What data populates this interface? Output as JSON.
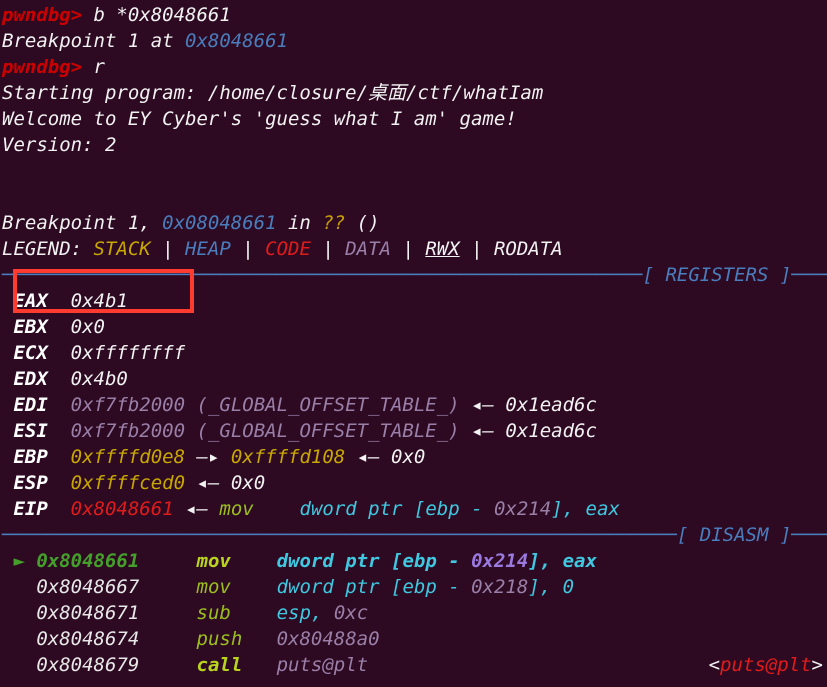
{
  "terminal": {
    "background_color": "#2d0a22",
    "foreground_color": "#f2f2f2",
    "prompt_color": "#cc0000",
    "annotation_box_color": "#ff3b30"
  },
  "session": {
    "prompt1": "pwndbg>",
    "command1": " b *0x8048661",
    "breakpoint_set_prefix": "Breakpoint 1 at ",
    "breakpoint_set_addr": "0x8048661",
    "prompt2": "pwndbg>",
    "command2": " r",
    "starting_program": "Starting program: /home/closure/桌面/ctf/whatIam",
    "welcome": "Welcome to EY Cyber's 'guess what I am' game!",
    "version": "Version: 2",
    "hit_prefix": "Breakpoint 1, ",
    "hit_addr": "0x08048661",
    "hit_in": " in ",
    "hit_fn": "??",
    "hit_paren": " ()"
  },
  "legend": {
    "label": "LEGEND: ",
    "items": [
      {
        "text": "STACK",
        "color": "#c8a800"
      },
      {
        "text": "HEAP",
        "color": "#4a7dbd"
      },
      {
        "text": "CODE",
        "color": "#e01b1b"
      },
      {
        "text": "DATA",
        "color": "#9a7fa8"
      },
      {
        "text": "RWX",
        "color": "#f2f2f2"
      },
      {
        "text": "RODATA",
        "color": "#f2f2f2"
      }
    ],
    "separator": " | "
  },
  "sections": {
    "registers_title": "[ REGISTERS ]",
    "registers_dashes_left": "────────────────────────────────────────────────────────",
    "registers_dashes_right": "────────────────",
    "disasm_title": "[ DISASM ]",
    "disasm_dashes_left": "───────────────────────────────────────────────────────────",
    "disasm_dashes_right": "───────────────"
  },
  "registers": [
    {
      "name": "EAX",
      "value": "0x4b1",
      "value_class": "white",
      "rest": "",
      "highlighted": true
    },
    {
      "name": "EBX",
      "value": "0x0",
      "value_class": "white",
      "rest": ""
    },
    {
      "name": "ECX",
      "value": "0xffffffff",
      "value_class": "white",
      "rest": ""
    },
    {
      "name": "EDX",
      "value": "0x4b0",
      "value_class": "white",
      "rest": ""
    },
    {
      "name": "EDI",
      "value": "0xf7fb2000 (_GLOBAL_OFFSET_TABLE_)",
      "value_class": "data",
      "arrow": "◂—",
      "rest": "0x1ead6c"
    },
    {
      "name": "ESI",
      "value": "0xf7fb2000 (_GLOBAL_OFFSET_TABLE_)",
      "value_class": "data",
      "arrow": "◂—",
      "rest": "0x1ead6c"
    },
    {
      "name": "EBP",
      "value": "0xffffd0e8",
      "value_class": "stack",
      "arrow": "—▸",
      "rest": "0xffffd108",
      "arrow2": "◂—",
      "rest2": "0x0"
    },
    {
      "name": "ESP",
      "value": "0xffffced0",
      "value_class": "stack",
      "arrow": "◂—",
      "rest": "0x0"
    },
    {
      "name": "EIP",
      "value": "0x8048661",
      "value_class": "code",
      "arrow": "◂—",
      "rest": "mov    dword ptr [ebp - 0x214], eax"
    }
  ],
  "eip_disasm": {
    "mnemonic": "mov",
    "operand_pre": "dword ptr [ebp - ",
    "operand_imm": "0x214",
    "operand_post": "], eax"
  },
  "disasm": [
    {
      "marker": "►",
      "addr": "0x8048661",
      "mnemonic": "mov",
      "op_pre": "dword ptr [ebp - ",
      "op_imm": "0x214",
      "op_post": "], eax",
      "current": true,
      "tag": ""
    },
    {
      "marker": " ",
      "addr": "0x8048667",
      "mnemonic": "mov",
      "op_pre": "dword ptr [ebp - ",
      "op_imm": "0x218",
      "op_post": "], 0",
      "current": false,
      "tag": ""
    },
    {
      "marker": " ",
      "addr": "0x8048671",
      "mnemonic": "sub",
      "op_pre": "esp, ",
      "op_imm": "0xc",
      "op_post": "",
      "current": false,
      "tag": ""
    },
    {
      "marker": " ",
      "addr": "0x8048674",
      "mnemonic": "push",
      "op_pre": "",
      "op_imm": "0x80488a0",
      "op_post": "",
      "current": false,
      "tag": ""
    },
    {
      "marker": " ",
      "addr": "0x8048679",
      "mnemonic": "call",
      "op_pre": "",
      "op_imm": "puts@plt",
      "op_post": "",
      "current": false,
      "tag": "<puts@plt>",
      "tag_open": "<",
      "tag_name": "puts@plt",
      "tag_close": ">"
    }
  ]
}
